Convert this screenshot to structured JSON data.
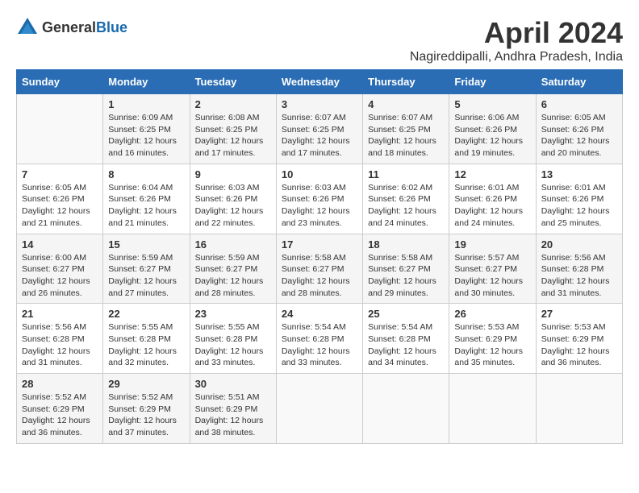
{
  "header": {
    "logo_general": "General",
    "logo_blue": "Blue",
    "month_year": "April 2024",
    "location": "Nagireddipalli, Andhra Pradesh, India"
  },
  "calendar": {
    "days_of_week": [
      "Sunday",
      "Monday",
      "Tuesday",
      "Wednesday",
      "Thursday",
      "Friday",
      "Saturday"
    ],
    "weeks": [
      [
        {
          "day": "",
          "content": ""
        },
        {
          "day": "1",
          "content": "Sunrise: 6:09 AM\nSunset: 6:25 PM\nDaylight: 12 hours\nand 16 minutes."
        },
        {
          "day": "2",
          "content": "Sunrise: 6:08 AM\nSunset: 6:25 PM\nDaylight: 12 hours\nand 17 minutes."
        },
        {
          "day": "3",
          "content": "Sunrise: 6:07 AM\nSunset: 6:25 PM\nDaylight: 12 hours\nand 17 minutes."
        },
        {
          "day": "4",
          "content": "Sunrise: 6:07 AM\nSunset: 6:25 PM\nDaylight: 12 hours\nand 18 minutes."
        },
        {
          "day": "5",
          "content": "Sunrise: 6:06 AM\nSunset: 6:26 PM\nDaylight: 12 hours\nand 19 minutes."
        },
        {
          "day": "6",
          "content": "Sunrise: 6:05 AM\nSunset: 6:26 PM\nDaylight: 12 hours\nand 20 minutes."
        }
      ],
      [
        {
          "day": "7",
          "content": "Sunrise: 6:05 AM\nSunset: 6:26 PM\nDaylight: 12 hours\nand 21 minutes."
        },
        {
          "day": "8",
          "content": "Sunrise: 6:04 AM\nSunset: 6:26 PM\nDaylight: 12 hours\nand 21 minutes."
        },
        {
          "day": "9",
          "content": "Sunrise: 6:03 AM\nSunset: 6:26 PM\nDaylight: 12 hours\nand 22 minutes."
        },
        {
          "day": "10",
          "content": "Sunrise: 6:03 AM\nSunset: 6:26 PM\nDaylight: 12 hours\nand 23 minutes."
        },
        {
          "day": "11",
          "content": "Sunrise: 6:02 AM\nSunset: 6:26 PM\nDaylight: 12 hours\nand 24 minutes."
        },
        {
          "day": "12",
          "content": "Sunrise: 6:01 AM\nSunset: 6:26 PM\nDaylight: 12 hours\nand 24 minutes."
        },
        {
          "day": "13",
          "content": "Sunrise: 6:01 AM\nSunset: 6:26 PM\nDaylight: 12 hours\nand 25 minutes."
        }
      ],
      [
        {
          "day": "14",
          "content": "Sunrise: 6:00 AM\nSunset: 6:27 PM\nDaylight: 12 hours\nand 26 minutes."
        },
        {
          "day": "15",
          "content": "Sunrise: 5:59 AM\nSunset: 6:27 PM\nDaylight: 12 hours\nand 27 minutes."
        },
        {
          "day": "16",
          "content": "Sunrise: 5:59 AM\nSunset: 6:27 PM\nDaylight: 12 hours\nand 28 minutes."
        },
        {
          "day": "17",
          "content": "Sunrise: 5:58 AM\nSunset: 6:27 PM\nDaylight: 12 hours\nand 28 minutes."
        },
        {
          "day": "18",
          "content": "Sunrise: 5:58 AM\nSunset: 6:27 PM\nDaylight: 12 hours\nand 29 minutes."
        },
        {
          "day": "19",
          "content": "Sunrise: 5:57 AM\nSunset: 6:27 PM\nDaylight: 12 hours\nand 30 minutes."
        },
        {
          "day": "20",
          "content": "Sunrise: 5:56 AM\nSunset: 6:28 PM\nDaylight: 12 hours\nand 31 minutes."
        }
      ],
      [
        {
          "day": "21",
          "content": "Sunrise: 5:56 AM\nSunset: 6:28 PM\nDaylight: 12 hours\nand 31 minutes."
        },
        {
          "day": "22",
          "content": "Sunrise: 5:55 AM\nSunset: 6:28 PM\nDaylight: 12 hours\nand 32 minutes."
        },
        {
          "day": "23",
          "content": "Sunrise: 5:55 AM\nSunset: 6:28 PM\nDaylight: 12 hours\nand 33 minutes."
        },
        {
          "day": "24",
          "content": "Sunrise: 5:54 AM\nSunset: 6:28 PM\nDaylight: 12 hours\nand 33 minutes."
        },
        {
          "day": "25",
          "content": "Sunrise: 5:54 AM\nSunset: 6:28 PM\nDaylight: 12 hours\nand 34 minutes."
        },
        {
          "day": "26",
          "content": "Sunrise: 5:53 AM\nSunset: 6:29 PM\nDaylight: 12 hours\nand 35 minutes."
        },
        {
          "day": "27",
          "content": "Sunrise: 5:53 AM\nSunset: 6:29 PM\nDaylight: 12 hours\nand 36 minutes."
        }
      ],
      [
        {
          "day": "28",
          "content": "Sunrise: 5:52 AM\nSunset: 6:29 PM\nDaylight: 12 hours\nand 36 minutes."
        },
        {
          "day": "29",
          "content": "Sunrise: 5:52 AM\nSunset: 6:29 PM\nDaylight: 12 hours\nand 37 minutes."
        },
        {
          "day": "30",
          "content": "Sunrise: 5:51 AM\nSunset: 6:29 PM\nDaylight: 12 hours\nand 38 minutes."
        },
        {
          "day": "",
          "content": ""
        },
        {
          "day": "",
          "content": ""
        },
        {
          "day": "",
          "content": ""
        },
        {
          "day": "",
          "content": ""
        }
      ]
    ]
  }
}
